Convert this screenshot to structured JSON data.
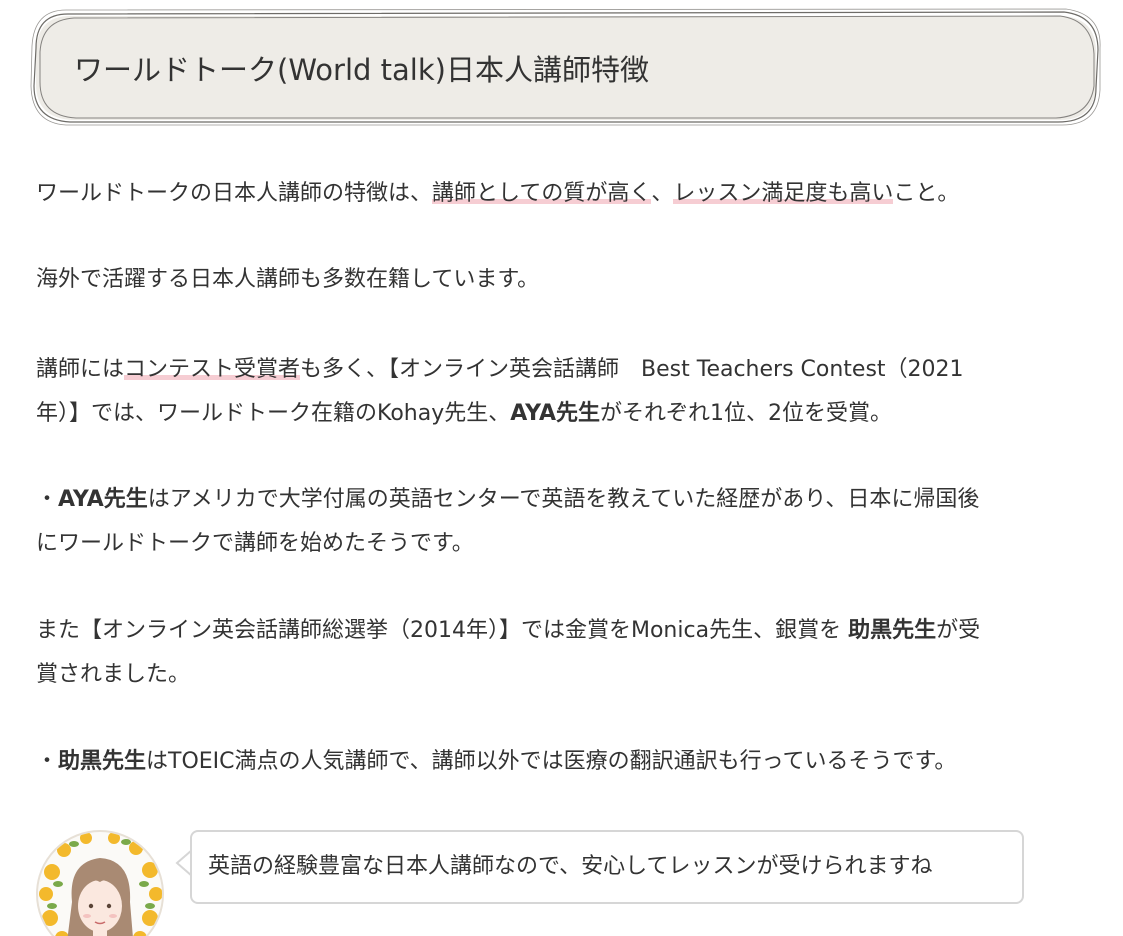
{
  "heading": {
    "title": "ワールドトーク(World talk)日本人講師特徴"
  },
  "paragraphs": {
    "p1": {
      "a": "ワールドトークの日本人講師の特徴は、",
      "h1": "講師としての質が高く",
      "b": "、",
      "h2": "レッスン満足度も高い",
      "c": "こと。"
    },
    "p2": "海外で活躍する日本人講師も多数在籍しています。",
    "p3": {
      "a": "講師には",
      "h": "コンテスト受賞者",
      "b": "も多く、【オンライン英会話講師　Best Teachers Contest（2021",
      "c": "年）】では、ワールドトーク在籍のKohay先生、",
      "bold": "AYA先生",
      "d": "がそれぞれ1位、2位を受賞。"
    },
    "p4": {
      "bullet": "・",
      "bold": "AYA先生",
      "a": "はアメリカで大学付属の英語センターで英語を教えていた経歴があり、日本に帰国後",
      "b": "にワールドトークで講師を始めたそうです。"
    },
    "p5": {
      "a": "また【オンライン英会話講師総選挙（2014年）】では金賞をMonica先生、銀賞を ",
      "bold": "助黒先生",
      "b": "が受",
      "c": "賞されました。"
    },
    "p6": {
      "bullet": "・",
      "bold": "助黒先生",
      "a": "はTOEIC満点の人気講師で、講師以外では医療の翻訳通訳も行っているそうです。"
    }
  },
  "speech": {
    "avatar_icon": "woman-avatar-icon",
    "text": "英語の経験豊富な日本人講師なので、安心してレッスンが受けられますね"
  },
  "colors": {
    "heading_bg": "#eeece7",
    "highlight": "#f6cdd3",
    "text": "#333333",
    "bubble_border": "#d6d6d6"
  }
}
